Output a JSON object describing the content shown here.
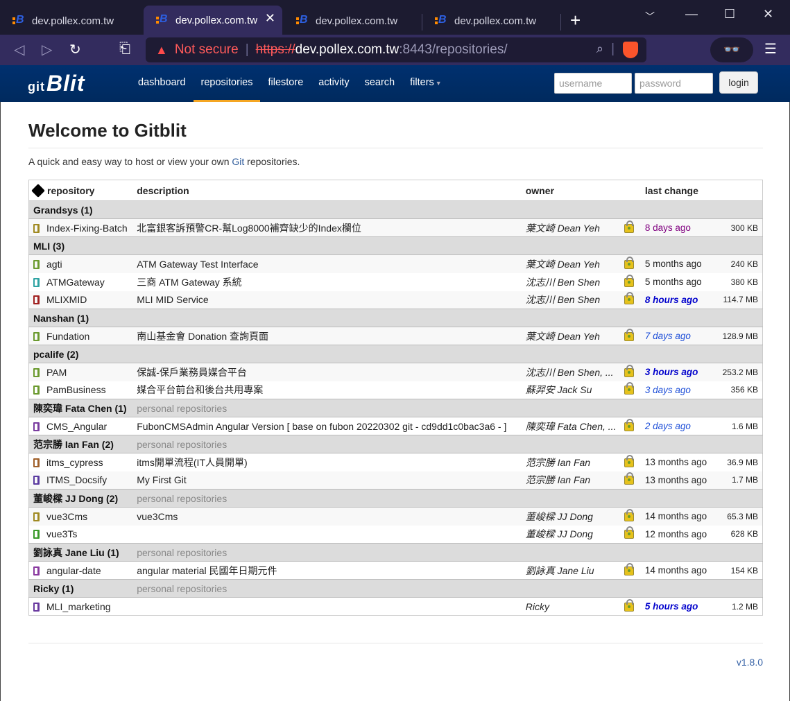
{
  "browser": {
    "tabs": [
      {
        "title": "dev.pollex.com.tw",
        "active": false
      },
      {
        "title": "dev.pollex.com.tw",
        "active": true
      },
      {
        "title": "dev.pollex.com.tw",
        "active": false
      },
      {
        "title": "dev.pollex.com.tw",
        "active": false
      }
    ],
    "security_text": "Not secure",
    "url_protocol": "https://",
    "url_host": "dev.pollex.com.tw",
    "url_path": ":8443/repositories/"
  },
  "navbar": {
    "logo": "Blit",
    "logo_prefix": "git",
    "items": [
      "dashboard",
      "repositories",
      "filestore",
      "activity",
      "search",
      "filters"
    ],
    "active_item": "repositories",
    "username_placeholder": "username",
    "password_placeholder": "password",
    "login_label": "login"
  },
  "page": {
    "title": "Welcome to Gitblit",
    "intro_before": "A quick and easy way to host or view your own ",
    "intro_link": "Git",
    "intro_after": " repositories.",
    "version": "v1.8.0"
  },
  "table": {
    "headers": {
      "repository": "repository",
      "description": "description",
      "owner": "owner",
      "last_change": "last change"
    },
    "groups": [
      {
        "name": "Grandsys (1)",
        "desc": "",
        "repos": [
          {
            "name": "Index-Fixing-Batch",
            "description": "北富銀客訴預警CR-幫Log8000補齊缺少的Index欄位",
            "owner": "葉文崎 Dean Yeh",
            "last_change": "8 days ago",
            "age_class": "week",
            "size": "300 KB",
            "icon_color": "#a08a22"
          }
        ]
      },
      {
        "name": "MLI (3)",
        "desc": "",
        "repos": [
          {
            "name": "agti",
            "description": "ATM Gateway Test Interface",
            "owner": "葉文崎 Dean Yeh",
            "last_change": "5 months ago",
            "age_class": "old",
            "size": "240 KB",
            "icon_color": "#6b9a2f"
          },
          {
            "name": "ATMGateway",
            "description": "三商 ATM Gateway 系統",
            "owner": "沈志川 Ben Shen",
            "last_change": "5 months ago",
            "age_class": "old",
            "size": "380 KB",
            "icon_color": "#2fa3a3"
          },
          {
            "name": "MLIXMID",
            "description": "MLI MID Service",
            "owner": "沈志川 Ben Shen",
            "last_change": "8 hours ago",
            "age_class": "recent",
            "size": "114.7 MB",
            "icon_color": "#a02020"
          }
        ]
      },
      {
        "name": "Nanshan (1)",
        "desc": "",
        "repos": [
          {
            "name": "Fundation",
            "description": "南山基金會 Donation 查詢頁面",
            "owner": "葉文崎 Dean Yeh",
            "last_change": "7 days ago",
            "age_class": "days",
            "size": "128.9 MB",
            "icon_color": "#6b9a2f"
          }
        ]
      },
      {
        "name": "pcalife (2)",
        "desc": "",
        "repos": [
          {
            "name": "PAM",
            "description": "保誠-保戶業務員媒合平台",
            "owner": "沈志川 Ben Shen, ...",
            "last_change": "3 hours ago",
            "age_class": "recent",
            "size": "253.2 MB",
            "icon_color": "#6b9a2f"
          },
          {
            "name": "PamBusiness",
            "description": "媒合平台前台和後台共用專案",
            "owner": "蘇羿安 Jack Su",
            "last_change": "3 days ago",
            "age_class": "days",
            "size": "356 KB",
            "icon_color": "#6b9a2f"
          }
        ]
      },
      {
        "name": "陳奕瑋 Fata Chen (1)",
        "desc": "personal repositories",
        "repos": [
          {
            "name": "CMS_Angular",
            "description": "FubonCMSAdmin Angular Version [ base on fubon 20220302 git - cd9dd1c0bac3a6 - ]",
            "owner": "陳奕瑋 Fata Chen, ...",
            "last_change": "2 days ago",
            "age_class": "days",
            "size": "1.6 MB",
            "icon_color": "#7a3da0"
          }
        ]
      },
      {
        "name": "范宗勝 Ian Fan (2)",
        "desc": "personal repositories",
        "repos": [
          {
            "name": "itms_cypress",
            "description": "itms開單流程(IT人員開單)",
            "owner": "范宗勝 Ian Fan",
            "last_change": "13 months ago",
            "age_class": "old",
            "size": "36.9 MB",
            "icon_color": "#a0602a"
          },
          {
            "name": "ITMS_Docsify",
            "description": "My First Git",
            "owner": "范宗勝 Ian Fan",
            "last_change": "13 months ago",
            "age_class": "old",
            "size": "1.7 MB",
            "icon_color": "#5a3aa0"
          }
        ]
      },
      {
        "name": "董峻樑 JJ Dong (2)",
        "desc": "personal repositories",
        "repos": [
          {
            "name": "vue3Cms",
            "description": "vue3Cms",
            "owner": "董峻樑 JJ Dong",
            "last_change": "14 months ago",
            "age_class": "old",
            "size": "65.3 MB",
            "icon_color": "#a08a22"
          },
          {
            "name": "vue3Ts",
            "description": "",
            "owner": "董峻樑 JJ Dong",
            "last_change": "12 months ago",
            "age_class": "old",
            "size": "628 KB",
            "icon_color": "#3a9a2a"
          }
        ]
      },
      {
        "name": "劉詠真 Jane Liu (1)",
        "desc": "personal repositories",
        "repos": [
          {
            "name": "angular-date",
            "description": "angular material 民國年日期元件",
            "owner": "劉詠真 Jane Liu",
            "last_change": "14 months ago",
            "age_class": "old",
            "size": "154 KB",
            "icon_color": "#8a3aa0"
          }
        ]
      },
      {
        "name": "Ricky (1)",
        "desc": "personal repositories",
        "repos": [
          {
            "name": "MLI_marketing",
            "description": "",
            "owner": "Ricky",
            "last_change": "5 hours ago",
            "age_class": "recent",
            "size": "1.2 MB",
            "icon_color": "#6a3aa0"
          }
        ]
      }
    ]
  }
}
